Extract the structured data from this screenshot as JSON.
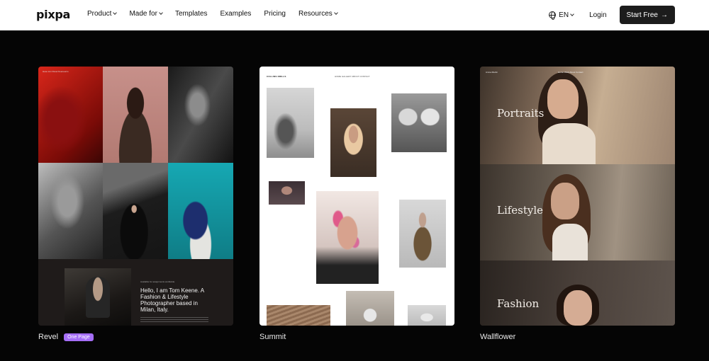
{
  "nav": {
    "logo": "pixpa",
    "items": [
      {
        "label": "Product",
        "dropdown": true
      },
      {
        "label": "Made for",
        "dropdown": true
      },
      {
        "label": "Templates",
        "dropdown": false
      },
      {
        "label": "Examples",
        "dropdown": false
      },
      {
        "label": "Pricing",
        "dropdown": false
      },
      {
        "label": "Resources",
        "dropdown": true
      }
    ],
    "language": "EN",
    "login": "Login",
    "cta": "Start Free",
    "cta_icon": "arrow-right-icon"
  },
  "templates": [
    {
      "name": "Revel",
      "badge": "One Page",
      "preview": {
        "header": "Hese tom Revel Keeneerns",
        "intro_small": "Available for assignments worldwide",
        "intro": "Hello, I am Tom Keene. A Fashion & Lifestyle Photographer based in Milan, Italy."
      }
    },
    {
      "name": "Summit",
      "preview": {
        "site_name": "COLLINS DRILLS",
        "menu": "HOME    GALLERY    ABOUT    CONTACT"
      }
    },
    {
      "name": "Wallflower",
      "preview": {
        "site_name": "Amna Martin",
        "menu": "Home   Work   About   Contact",
        "sections": [
          "Portraits",
          "Lifestyle",
          "Fashion"
        ]
      }
    }
  ],
  "colors": {
    "background": "#050505",
    "cta_background": "#1c1c1c",
    "badge": "#a56ef7"
  }
}
